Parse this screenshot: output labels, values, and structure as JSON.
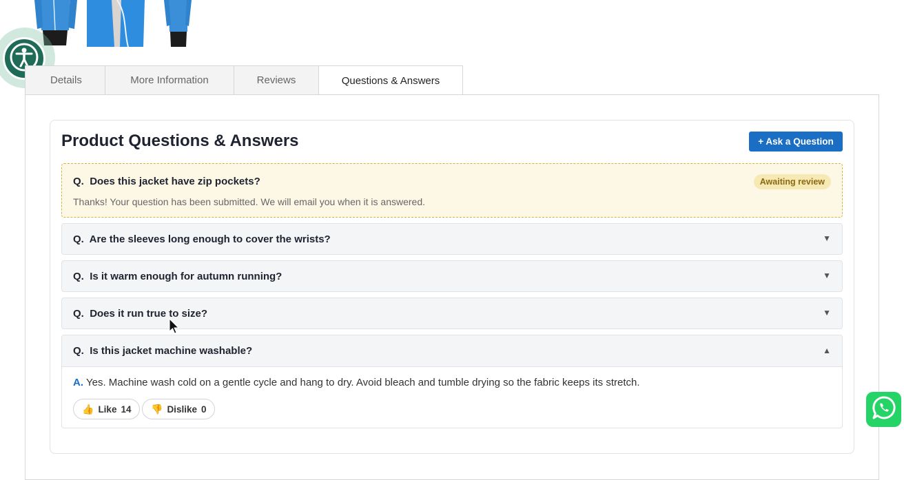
{
  "tabs": [
    {
      "label": "Details"
    },
    {
      "label": "More Information"
    },
    {
      "label": "Reviews"
    },
    {
      "label": "Questions & Answers"
    }
  ],
  "qa": {
    "title": "Product Questions & Answers",
    "ask_button": "+ Ask a Question",
    "pending": {
      "prefix": "Q.",
      "question": "Does this jacket have zip pockets?",
      "badge": "Awaiting review",
      "message": "Thanks! Your question has been submitted. We will email you when it is answered."
    },
    "questions": [
      {
        "prefix": "Q.",
        "text": "Are the sleeves long enough to cover the wrists?",
        "chevron": "▼"
      },
      {
        "prefix": "Q.",
        "text": "Is it warm enough for autumn running?",
        "chevron": "▼"
      },
      {
        "prefix": "Q.",
        "text": "Does it run true to size?",
        "chevron": "▼"
      }
    ],
    "expanded": {
      "prefix": "Q.",
      "question": "Is this jacket machine washable?",
      "chevron": "▲",
      "answer_prefix": "A.",
      "answer": "Yes. Machine wash cold on a gentle cycle and hang to dry. Avoid bleach and tumble drying so the fabric keeps its stretch.",
      "like_label": "Like",
      "like_count": "14",
      "dislike_label": "Dislike",
      "dislike_count": "0"
    }
  },
  "colors": {
    "accent": "#1a6fc4",
    "pending_border": "#d4b53c",
    "pending_bg": "#fdf8e6",
    "thumb_active": "#e8642d",
    "whatsapp": "#25d366",
    "a11y": "#1e6b58"
  },
  "icons": {
    "accessibility": "accessibility-person-icon",
    "whatsapp": "whatsapp-icon",
    "like": "thumbs-up-icon",
    "dislike": "thumbs-down-icon"
  }
}
